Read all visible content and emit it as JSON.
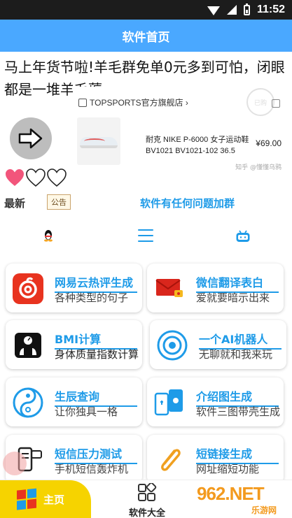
{
  "status_bar": {
    "time": "11:52"
  },
  "header": {
    "title": "软件首页"
  },
  "marquee": {
    "text": "马上年货节啦!羊毛群免单0元多到可怕，闭眼都是一堆羊毛薅"
  },
  "ad": {
    "store": "TOPSPORTS官方旗舰店 ›",
    "product": "耐克 NIKE P-6000 女子运动鞋 BV1021 BV1021-102 36.5",
    "price": "¥69.00",
    "source": "知乎 @懂懂乌鸦",
    "stamp": "已购"
  },
  "widgets": {
    "latest": "最新",
    "notice_badge": "公告",
    "notice_link": "软件有任何问题加群"
  },
  "cards": [
    {
      "title": "网易云热评生成",
      "subtitle": "各种类型的句子",
      "icon": "netease-music-icon",
      "color": "#e8331f"
    },
    {
      "title": "微信翻译表白",
      "subtitle": "爱就要暗示出来",
      "icon": "red-envelope-icon",
      "color": "#d9261c"
    },
    {
      "title": "BMI计算",
      "subtitle": "身体质量指数计算",
      "icon": "scale-icon",
      "color": "#111111"
    },
    {
      "title": "一个AI机器人",
      "subtitle": "无聊就和我来玩",
      "icon": "ai-robot-icon",
      "color": "#1e9be8"
    },
    {
      "title": "生辰查询",
      "subtitle": "让你独具一格",
      "icon": "yin-yang-icon",
      "color": "#1e9be8"
    },
    {
      "title": "介绍图生成",
      "subtitle": "软件三图带壳生成",
      "icon": "phone-frames-icon",
      "color": "#1e9be8"
    },
    {
      "title": "短信压力测试",
      "subtitle": "手机短信轰炸机",
      "icon": "sms-icon",
      "color": "#1e9be8"
    },
    {
      "title": "短链接生成",
      "subtitle": "网址缩短功能",
      "icon": "paperclip-icon",
      "color": "#f0a020"
    }
  ],
  "bottom_nav": {
    "home": "主页",
    "all": "软件大全",
    "watermark_main": "962.NET",
    "watermark_sub": "乐游网"
  },
  "colors": {
    "accent": "#1e9be8",
    "header": "#4aa8ff",
    "home_tab": "#f6d300"
  }
}
